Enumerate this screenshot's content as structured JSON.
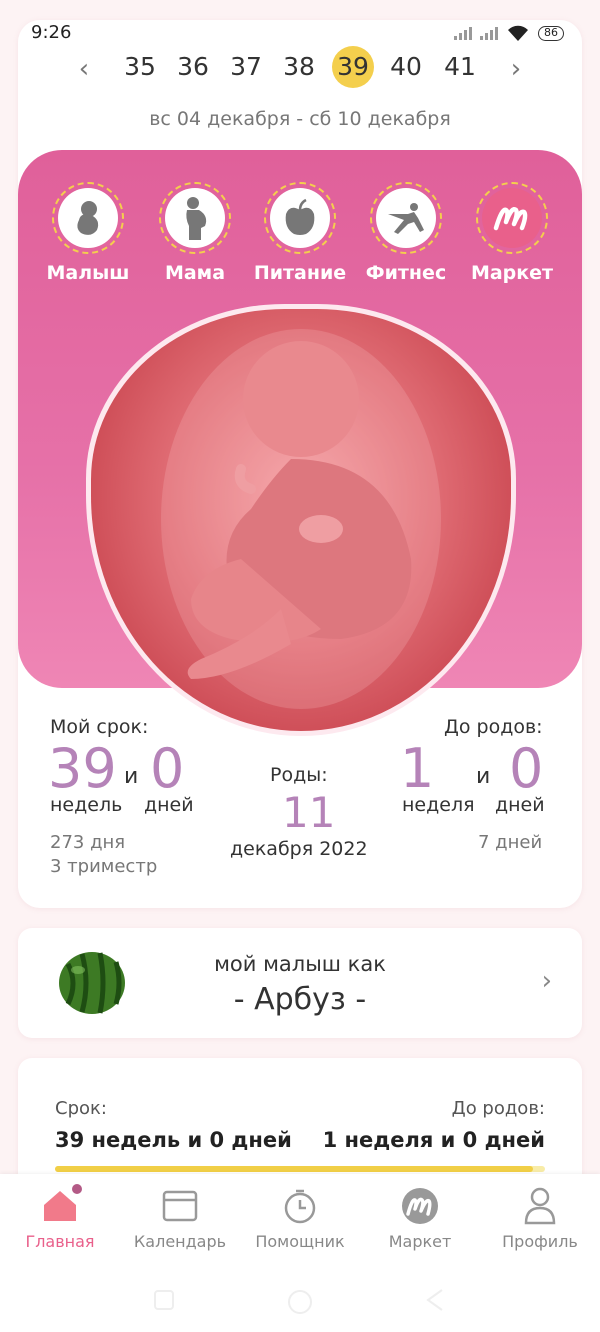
{
  "status": {
    "time": "9:26",
    "battery": "86"
  },
  "weeks": {
    "items": [
      "35",
      "36",
      "37",
      "38",
      "39",
      "40",
      "41"
    ],
    "active": "39"
  },
  "date_range": "вс 04 декабря - сб 10 декабря",
  "categories": [
    {
      "label": "Малыш",
      "icon": "baby-icon"
    },
    {
      "label": "Мама",
      "icon": "pregnant-mom-icon"
    },
    {
      "label": "Питание",
      "icon": "apple-icon"
    },
    {
      "label": "Фитнес",
      "icon": "fitness-icon"
    },
    {
      "label": "Маркет",
      "icon": "market-logo-icon"
    }
  ],
  "term": {
    "title": "Мой срок:",
    "weeks": "39",
    "and": "и",
    "days": "0",
    "weeks_label": "недель",
    "days_label": "дней",
    "days_total": "273 дня",
    "trimester": "3 триместр"
  },
  "birth": {
    "title": "Роды:",
    "day": "11",
    "month_year": "декабря 2022"
  },
  "until": {
    "title": "До родов:",
    "weeks": "1",
    "and": "и",
    "days": "0",
    "weeks_label": "неделя",
    "days_label": "дней",
    "days_total": "7 дней"
  },
  "fruit": {
    "subtitle": "мой малыш как",
    "name": "- Арбуз -"
  },
  "progress": {
    "term_label": "Срок:",
    "term_value": "39 недель и 0 дней",
    "until_label": "До родов:",
    "until_value": "1 неделя и 0 дней",
    "fraction": 0.975
  },
  "nav": [
    {
      "label": "Главная",
      "icon": "home-icon",
      "active": true
    },
    {
      "label": "Календарь",
      "icon": "calendar-icon",
      "active": false
    },
    {
      "label": "Помощник",
      "icon": "timer-icon",
      "active": false
    },
    {
      "label": "Маркет",
      "icon": "market-logo-icon",
      "active": false
    },
    {
      "label": "Профиль",
      "icon": "profile-icon",
      "active": false
    }
  ],
  "colors": {
    "accent_pink": "#e0609a",
    "accent_yellow": "#f4cf4d",
    "number_purple": "#b583b8"
  }
}
